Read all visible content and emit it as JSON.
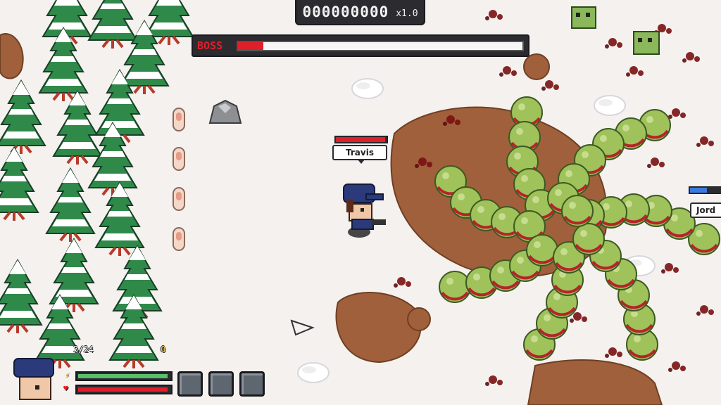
{
  "hud": {
    "score": "000000000",
    "multiplier": "x1.0",
    "boss_label": "BOSS",
    "boss_health": 0.1,
    "ammo": "3/24",
    "coins": "0",
    "health": 0.98,
    "stamina": 0.98,
    "weapon_slots": 3
  },
  "players": [
    {
      "name": "Travis",
      "health": 1.0
    },
    {
      "name": "Jord",
      "health": 0.6
    }
  ],
  "colors": {
    "snow": "#f4f1ef",
    "dirt": "#a0603b",
    "tree": "#2f8a4a",
    "boss_green": "#9fc25a",
    "blood": "#7a1010",
    "boss_red": "#e01f2a",
    "hud_dark": "#2b2b30"
  },
  "icons": {
    "stamina": "lightning-icon",
    "health": "heart-icon",
    "cursor": "aim-cursor-icon"
  }
}
